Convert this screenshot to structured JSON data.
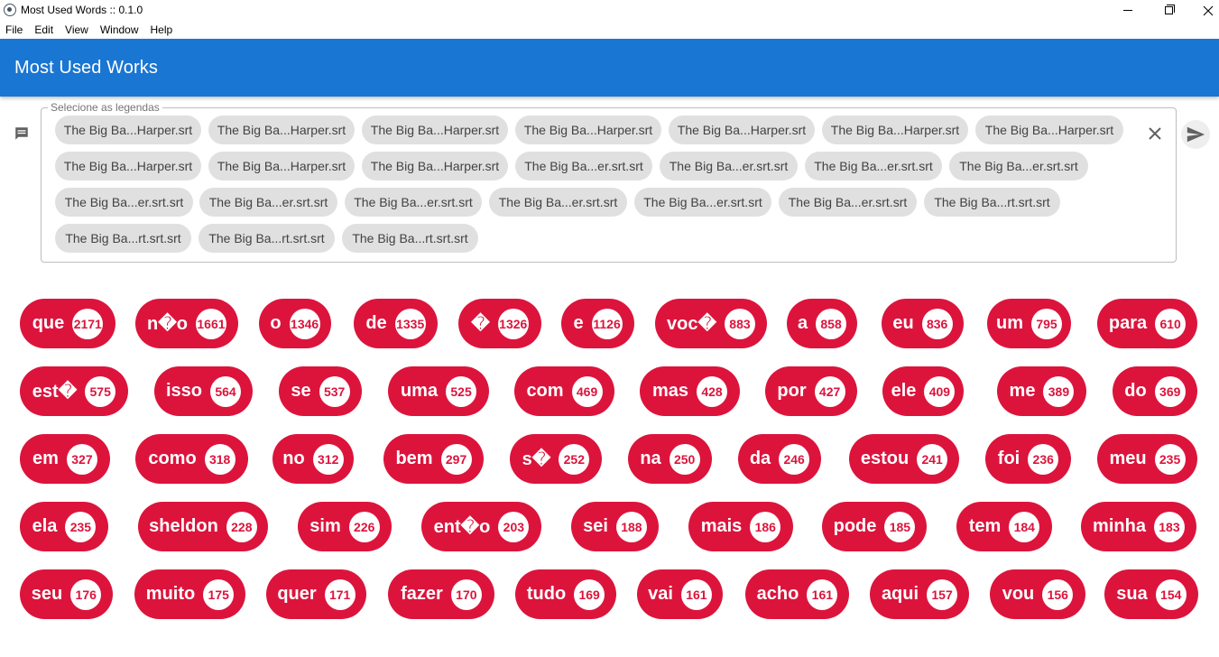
{
  "window": {
    "title": "Most Used Words :: 0.1.0",
    "icon": "electron-icon",
    "controls": [
      "minimize-icon",
      "maximize-icon",
      "close-icon"
    ]
  },
  "menubar": [
    "File",
    "Edit",
    "View",
    "Window",
    "Help"
  ],
  "appbar": {
    "title": "Most Used Works",
    "color": "#1976d2"
  },
  "select": {
    "legend": "Selecione as legendas",
    "icon": "subtitles-icon",
    "chips": [
      "The Big Ba...Harper.srt",
      "The Big Ba...Harper.srt",
      "The Big Ba...Harper.srt",
      "The Big Ba...Harper.srt",
      "The Big Ba...Harper.srt",
      "The Big Ba...Harper.srt",
      "The Big Ba...Harper.srt",
      "The Big Ba...Harper.srt",
      "The Big Ba...Harper.srt",
      "The Big Ba...Harper.srt",
      "The Big Ba...er.srt.srt",
      "The Big Ba...er.srt.srt",
      "The Big Ba...er.srt.srt",
      "The Big Ba...er.srt.srt",
      "The Big Ba...er.srt.srt",
      "The Big Ba...er.srt.srt",
      "The Big Ba...er.srt.srt",
      "The Big Ba...er.srt.srt",
      "The Big Ba...er.srt.srt",
      "The Big Ba...er.srt.srt",
      "The Big Ba...rt.srt.srt",
      "The Big Ba...rt.srt.srt",
      "The Big Ba...rt.srt.srt",
      "The Big Ba...rt.srt.srt"
    ],
    "clear_icon": "close-icon",
    "send_icon": "send-icon"
  },
  "word_color": "#dc143c",
  "words": [
    {
      "word": "que",
      "count": "2171"
    },
    {
      "word": "n�o",
      "count": "1661"
    },
    {
      "word": "o",
      "count": "1346"
    },
    {
      "word": "de",
      "count": "1335"
    },
    {
      "word": "�",
      "count": "1326"
    },
    {
      "word": "e",
      "count": "1126"
    },
    {
      "word": "voc�",
      "count": "883"
    },
    {
      "word": "a",
      "count": "858"
    },
    {
      "word": "eu",
      "count": "836"
    },
    {
      "word": "um",
      "count": "795"
    },
    {
      "word": "para",
      "count": "610"
    },
    {
      "word": "est�",
      "count": "575"
    },
    {
      "word": "isso",
      "count": "564"
    },
    {
      "word": "se",
      "count": "537"
    },
    {
      "word": "uma",
      "count": "525"
    },
    {
      "word": "com",
      "count": "469"
    },
    {
      "word": "mas",
      "count": "428"
    },
    {
      "word": "por",
      "count": "427"
    },
    {
      "word": "ele",
      "count": "409"
    },
    {
      "word": "me",
      "count": "389"
    },
    {
      "word": "do",
      "count": "369"
    },
    {
      "word": "em",
      "count": "327"
    },
    {
      "word": "como",
      "count": "318"
    },
    {
      "word": "no",
      "count": "312"
    },
    {
      "word": "bem",
      "count": "297"
    },
    {
      "word": "s�",
      "count": "252"
    },
    {
      "word": "na",
      "count": "250"
    },
    {
      "word": "da",
      "count": "246"
    },
    {
      "word": "estou",
      "count": "241"
    },
    {
      "word": "foi",
      "count": "236"
    },
    {
      "word": "meu",
      "count": "235"
    },
    {
      "word": "ela",
      "count": "235"
    },
    {
      "word": "sheldon",
      "count": "228"
    },
    {
      "word": "sim",
      "count": "226"
    },
    {
      "word": "ent�o",
      "count": "203"
    },
    {
      "word": "sei",
      "count": "188"
    },
    {
      "word": "mais",
      "count": "186"
    },
    {
      "word": "pode",
      "count": "185"
    },
    {
      "word": "tem",
      "count": "184"
    },
    {
      "word": "minha",
      "count": "183"
    },
    {
      "word": "seu",
      "count": "176"
    },
    {
      "word": "muito",
      "count": "175"
    },
    {
      "word": "quer",
      "count": "171"
    },
    {
      "word": "fazer",
      "count": "170"
    },
    {
      "word": "tudo",
      "count": "169"
    },
    {
      "word": "vai",
      "count": "161"
    },
    {
      "word": "acho",
      "count": "161"
    },
    {
      "word": "aqui",
      "count": "157"
    },
    {
      "word": "vou",
      "count": "156"
    },
    {
      "word": "sua",
      "count": "154"
    }
  ]
}
